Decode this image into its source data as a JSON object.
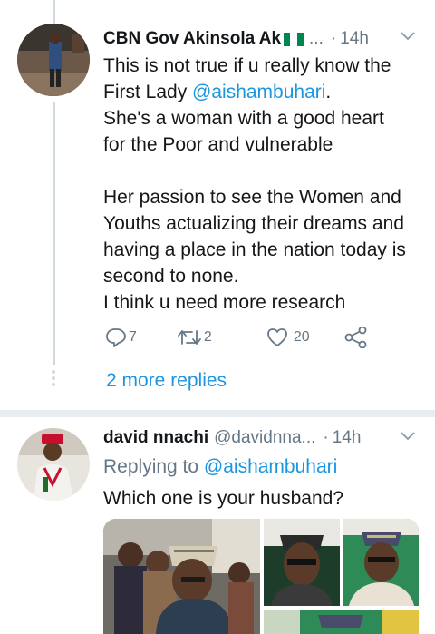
{
  "tweet1": {
    "name": "CBN Gov Akinsola Ak",
    "ellipsis": "...",
    "dot": "·",
    "time": "14h",
    "body_line1": "This is not true if u really know the",
    "body_line2_pre": "First Lady ",
    "mention": "@aishambuhari",
    "body_line2_post": ".",
    "body_line3": "She's a woman with a good heart",
    "body_line4": "for the Poor and vulnerable",
    "body_line5": "Her passion to see the Women and",
    "body_line6": "Youths actualizing their dreams and",
    "body_line7": "having a place in the nation today is",
    "body_line8": "second to none.",
    "body_line9": "I think u need more research",
    "reply_count": "7",
    "retweet_count": "2",
    "like_count": "20"
  },
  "more_replies_label": "2 more replies",
  "tweet2": {
    "name": "david nnachi",
    "handle": "@davidnna...",
    "dot": "·",
    "time": "14h",
    "replying_prefix": "Replying to ",
    "replying_to": "@aishambuhari",
    "body": "Which one is your husband?"
  },
  "colors": {
    "accent": "#1b95e0",
    "muted": "#657786",
    "divider": "#e6ecf0"
  },
  "icons": [
    "caret-down-icon",
    "reply-icon",
    "retweet-icon",
    "heart-icon",
    "share-icon",
    "nigeria-flag-icon"
  ]
}
